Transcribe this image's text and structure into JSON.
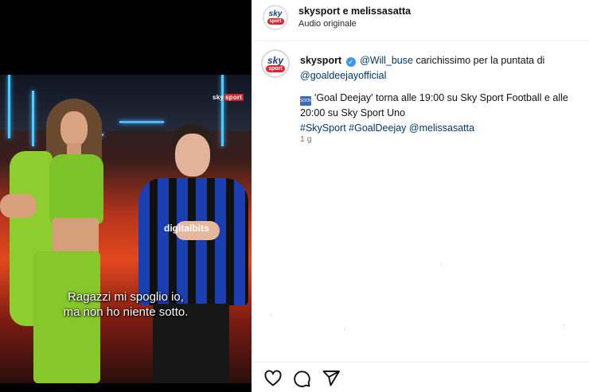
{
  "video": {
    "watermark_brand": "sky",
    "watermark_sport": "sport",
    "shirt_text": "digitalbits",
    "subtitle_line1": "Ragazzi mi spoglio io,",
    "subtitle_line2": "ma non ho niente sotto."
  },
  "header": {
    "username": "skysport e melissasatta",
    "audio": "Audio originale",
    "avatar_brand": "sky",
    "avatar_sport": "sport"
  },
  "post": {
    "author": "skysport",
    "avatar_brand": "sky",
    "avatar_sport": "sport",
    "mention1": "@Will_buse",
    "text1": " carichissimo per la puntata di",
    "mention2": "@goaldeejayofficial",
    "soon_label": "SOON",
    "text2": "'Goal Deejay' torna alle 19:00 su Sky Sport Football e alle 20:00 su Sky Sport Uno",
    "hashtag1": "#SkySport",
    "hashtag2": "#GoalDeejay",
    "mention3": "@melissasatta",
    "time": "1 g"
  },
  "actions": {
    "like_icon": "heart-icon",
    "comment_icon": "comment-icon",
    "share_icon": "send-icon"
  },
  "colors": {
    "link": "#00376b",
    "verified": "#3897f0",
    "sky_red": "#e2262d",
    "sky_blue": "#1a3a8a"
  }
}
